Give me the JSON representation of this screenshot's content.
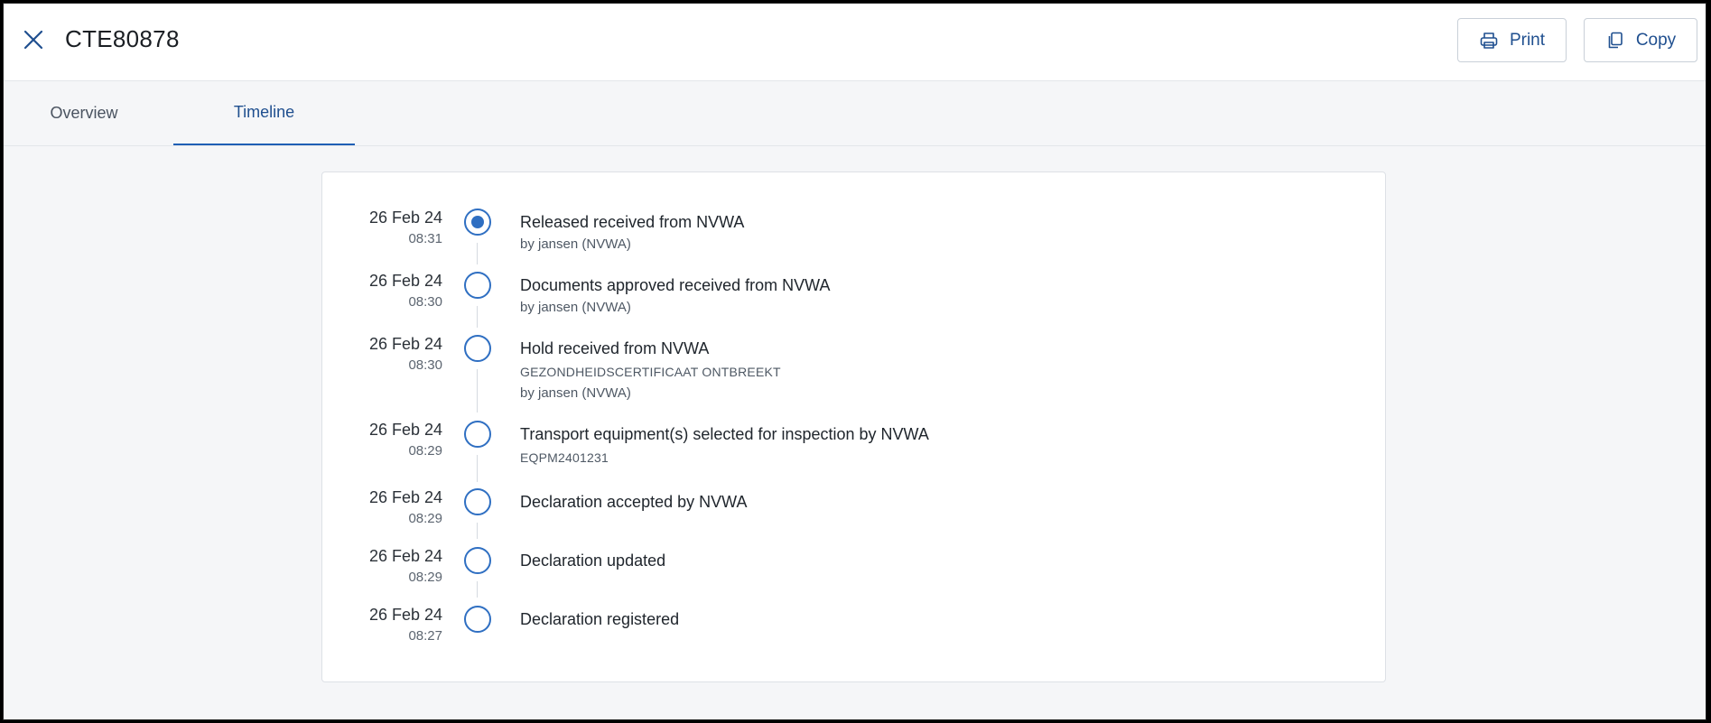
{
  "header": {
    "title": "CTE80878",
    "print_label": "Print",
    "copy_label": "Copy"
  },
  "tabs": [
    {
      "label": "Overview",
      "active": false
    },
    {
      "label": "Timeline",
      "active": true
    }
  ],
  "timeline": [
    {
      "date": "26 Feb 24",
      "time": "08:31",
      "title": "Released received from NVWA",
      "lines": [
        "by jansen (NVWA)"
      ],
      "active": true
    },
    {
      "date": "26 Feb 24",
      "time": "08:30",
      "title": "Documents approved received from NVWA",
      "lines": [
        "by jansen (NVWA)"
      ],
      "active": false
    },
    {
      "date": "26 Feb 24",
      "time": "08:30",
      "title": "Hold received from NVWA",
      "lines": [
        "GEZONDHEIDSCERTIFICAAT ONTBREEKT",
        "by jansen (NVWA)"
      ],
      "active": false
    },
    {
      "date": "26 Feb 24",
      "time": "08:29",
      "title": "Transport equipment(s) selected for inspection by NVWA",
      "lines": [
        "EQPM2401231"
      ],
      "active": false
    },
    {
      "date": "26 Feb 24",
      "time": "08:29",
      "title": "Declaration accepted by NVWA",
      "lines": [],
      "active": false
    },
    {
      "date": "26 Feb 24",
      "time": "08:29",
      "title": "Declaration updated",
      "lines": [],
      "active": false
    },
    {
      "date": "26 Feb 24",
      "time": "08:27",
      "title": "Declaration registered",
      "lines": [],
      "active": false
    }
  ],
  "colors": {
    "accent": "#2f6fc2",
    "tab_active": "#1f4f8f"
  }
}
